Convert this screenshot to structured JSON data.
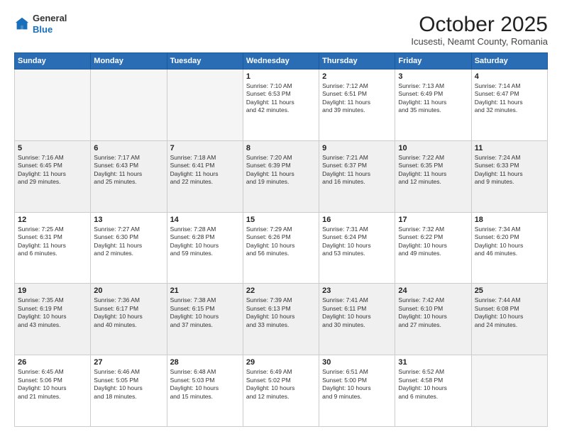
{
  "logo": {
    "general": "General",
    "blue": "Blue"
  },
  "header": {
    "title": "October 2025",
    "subtitle": "Icusesti, Neamt County, Romania"
  },
  "weekdays": [
    "Sunday",
    "Monday",
    "Tuesday",
    "Wednesday",
    "Thursday",
    "Friday",
    "Saturday"
  ],
  "weeks": [
    [
      {
        "day": "",
        "info": ""
      },
      {
        "day": "",
        "info": ""
      },
      {
        "day": "",
        "info": ""
      },
      {
        "day": "1",
        "info": "Sunrise: 7:10 AM\nSunset: 6:53 PM\nDaylight: 11 hours\nand 42 minutes."
      },
      {
        "day": "2",
        "info": "Sunrise: 7:12 AM\nSunset: 6:51 PM\nDaylight: 11 hours\nand 39 minutes."
      },
      {
        "day": "3",
        "info": "Sunrise: 7:13 AM\nSunset: 6:49 PM\nDaylight: 11 hours\nand 35 minutes."
      },
      {
        "day": "4",
        "info": "Sunrise: 7:14 AM\nSunset: 6:47 PM\nDaylight: 11 hours\nand 32 minutes."
      }
    ],
    [
      {
        "day": "5",
        "info": "Sunrise: 7:16 AM\nSunset: 6:45 PM\nDaylight: 11 hours\nand 29 minutes."
      },
      {
        "day": "6",
        "info": "Sunrise: 7:17 AM\nSunset: 6:43 PM\nDaylight: 11 hours\nand 25 minutes."
      },
      {
        "day": "7",
        "info": "Sunrise: 7:18 AM\nSunset: 6:41 PM\nDaylight: 11 hours\nand 22 minutes."
      },
      {
        "day": "8",
        "info": "Sunrise: 7:20 AM\nSunset: 6:39 PM\nDaylight: 11 hours\nand 19 minutes."
      },
      {
        "day": "9",
        "info": "Sunrise: 7:21 AM\nSunset: 6:37 PM\nDaylight: 11 hours\nand 16 minutes."
      },
      {
        "day": "10",
        "info": "Sunrise: 7:22 AM\nSunset: 6:35 PM\nDaylight: 11 hours\nand 12 minutes."
      },
      {
        "day": "11",
        "info": "Sunrise: 7:24 AM\nSunset: 6:33 PM\nDaylight: 11 hours\nand 9 minutes."
      }
    ],
    [
      {
        "day": "12",
        "info": "Sunrise: 7:25 AM\nSunset: 6:31 PM\nDaylight: 11 hours\nand 6 minutes."
      },
      {
        "day": "13",
        "info": "Sunrise: 7:27 AM\nSunset: 6:30 PM\nDaylight: 11 hours\nand 2 minutes."
      },
      {
        "day": "14",
        "info": "Sunrise: 7:28 AM\nSunset: 6:28 PM\nDaylight: 10 hours\nand 59 minutes."
      },
      {
        "day": "15",
        "info": "Sunrise: 7:29 AM\nSunset: 6:26 PM\nDaylight: 10 hours\nand 56 minutes."
      },
      {
        "day": "16",
        "info": "Sunrise: 7:31 AM\nSunset: 6:24 PM\nDaylight: 10 hours\nand 53 minutes."
      },
      {
        "day": "17",
        "info": "Sunrise: 7:32 AM\nSunset: 6:22 PM\nDaylight: 10 hours\nand 49 minutes."
      },
      {
        "day": "18",
        "info": "Sunrise: 7:34 AM\nSunset: 6:20 PM\nDaylight: 10 hours\nand 46 minutes."
      }
    ],
    [
      {
        "day": "19",
        "info": "Sunrise: 7:35 AM\nSunset: 6:19 PM\nDaylight: 10 hours\nand 43 minutes."
      },
      {
        "day": "20",
        "info": "Sunrise: 7:36 AM\nSunset: 6:17 PM\nDaylight: 10 hours\nand 40 minutes."
      },
      {
        "day": "21",
        "info": "Sunrise: 7:38 AM\nSunset: 6:15 PM\nDaylight: 10 hours\nand 37 minutes."
      },
      {
        "day": "22",
        "info": "Sunrise: 7:39 AM\nSunset: 6:13 PM\nDaylight: 10 hours\nand 33 minutes."
      },
      {
        "day": "23",
        "info": "Sunrise: 7:41 AM\nSunset: 6:11 PM\nDaylight: 10 hours\nand 30 minutes."
      },
      {
        "day": "24",
        "info": "Sunrise: 7:42 AM\nSunset: 6:10 PM\nDaylight: 10 hours\nand 27 minutes."
      },
      {
        "day": "25",
        "info": "Sunrise: 7:44 AM\nSunset: 6:08 PM\nDaylight: 10 hours\nand 24 minutes."
      }
    ],
    [
      {
        "day": "26",
        "info": "Sunrise: 6:45 AM\nSunset: 5:06 PM\nDaylight: 10 hours\nand 21 minutes."
      },
      {
        "day": "27",
        "info": "Sunrise: 6:46 AM\nSunset: 5:05 PM\nDaylight: 10 hours\nand 18 minutes."
      },
      {
        "day": "28",
        "info": "Sunrise: 6:48 AM\nSunset: 5:03 PM\nDaylight: 10 hours\nand 15 minutes."
      },
      {
        "day": "29",
        "info": "Sunrise: 6:49 AM\nSunset: 5:02 PM\nDaylight: 10 hours\nand 12 minutes."
      },
      {
        "day": "30",
        "info": "Sunrise: 6:51 AM\nSunset: 5:00 PM\nDaylight: 10 hours\nand 9 minutes."
      },
      {
        "day": "31",
        "info": "Sunrise: 6:52 AM\nSunset: 4:58 PM\nDaylight: 10 hours\nand 6 minutes."
      },
      {
        "day": "",
        "info": ""
      }
    ]
  ]
}
